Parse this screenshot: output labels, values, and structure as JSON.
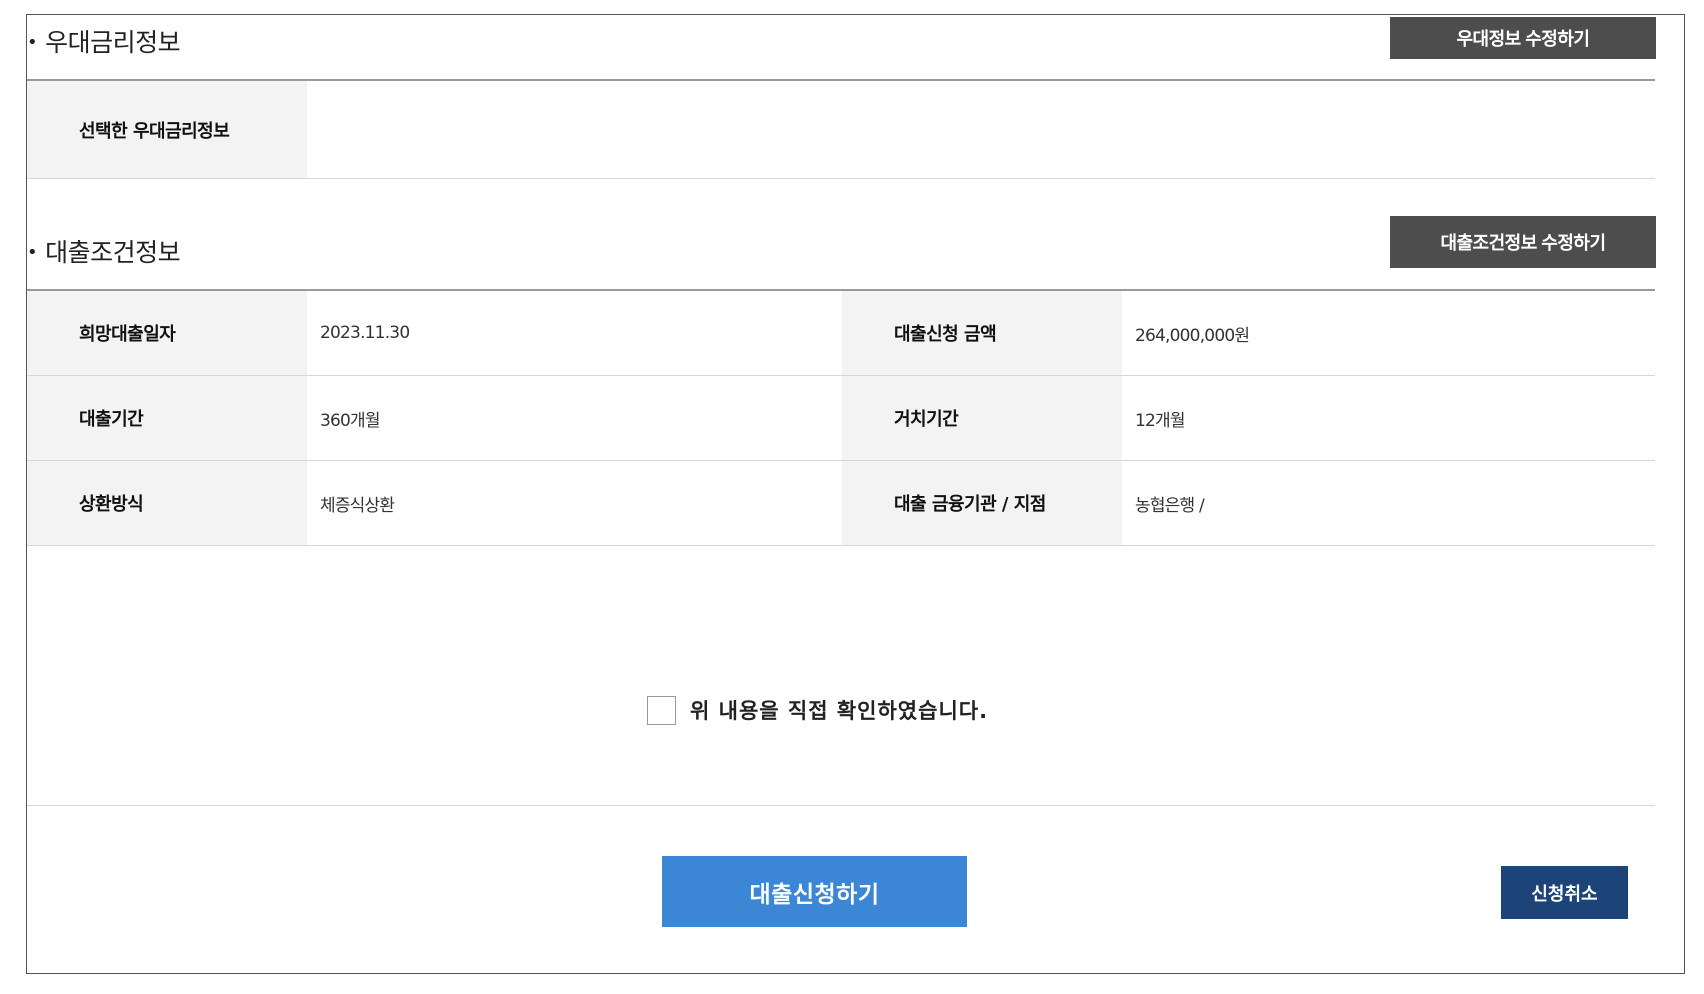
{
  "preference": {
    "section_title": "우대금리정보",
    "edit_button": "우대정보 수정하기",
    "selected_label": "선택한 우대금리정보",
    "selected_value": ""
  },
  "loan_conditions": {
    "section_title": "대출조건정보",
    "edit_button": "대출조건정보 수정하기",
    "rows": [
      {
        "left_label": "희망대출일자",
        "left_value": "2023.11.30",
        "right_label": "대출신청 금액",
        "right_value": "264,000,000원"
      },
      {
        "left_label": "대출기간",
        "left_value": "360개월",
        "right_label": "거치기간",
        "right_value": "12개월"
      },
      {
        "left_label": "상환방식",
        "left_value": "체증식상환",
        "right_label": "대출 금융기관 / 지점",
        "right_value": "농협은행 /"
      }
    ]
  },
  "confirmation": {
    "checkbox_label": "위 내용을 직접 확인하였습니다."
  },
  "actions": {
    "submit_label": "대출신청하기",
    "cancel_label": "신청취소"
  },
  "colors": {
    "primary": "#3b87d6",
    "cancel": "#1c4478",
    "dark_button": "#4d4d4d",
    "label_bg": "#f3f3f3"
  }
}
